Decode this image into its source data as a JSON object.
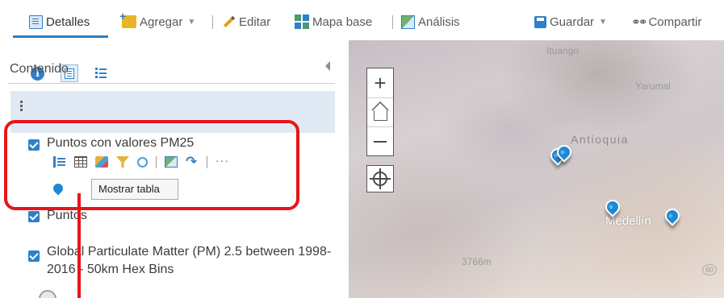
{
  "toolbar": {
    "details": "Detalles",
    "add": "Agregar",
    "edit": "Editar",
    "basemap": "Mapa base",
    "analysis": "Análisis",
    "save": "Guardar",
    "share": "Compartir"
  },
  "panel": {
    "section_title": "Contenido",
    "layers": [
      {
        "name": "Puntos con valores PM25",
        "checked": true,
        "selected": true
      },
      {
        "name": "Puntos",
        "checked": true
      },
      {
        "name": "Global Particulate Matter (PM) 2.5 between 1998-2016 - 50km Hex Bins",
        "checked": true
      }
    ],
    "tooltip": "Mostrar tabla"
  },
  "map": {
    "labels": {
      "ituango": "Ituango",
      "yarumal": "Yarumal",
      "antioquia": "Antioquia",
      "medellin": "Medellín",
      "elevation": "3766m",
      "road": "60"
    },
    "zoom_in": "+",
    "zoom_out": "−"
  },
  "colors": {
    "accent": "#2d7fc1",
    "highlight": "#e8141b",
    "selected_row": "#e1eaf4",
    "pin": "#1f88d4"
  },
  "icons": [
    "doc-icon",
    "add-layer-icon",
    "pencil-icon",
    "basemap-icon",
    "analysis-icon",
    "save-icon",
    "share-icon",
    "info-icon",
    "content-icon",
    "legend-icon",
    "home-icon",
    "locate-icon",
    "map-pin-icon"
  ]
}
